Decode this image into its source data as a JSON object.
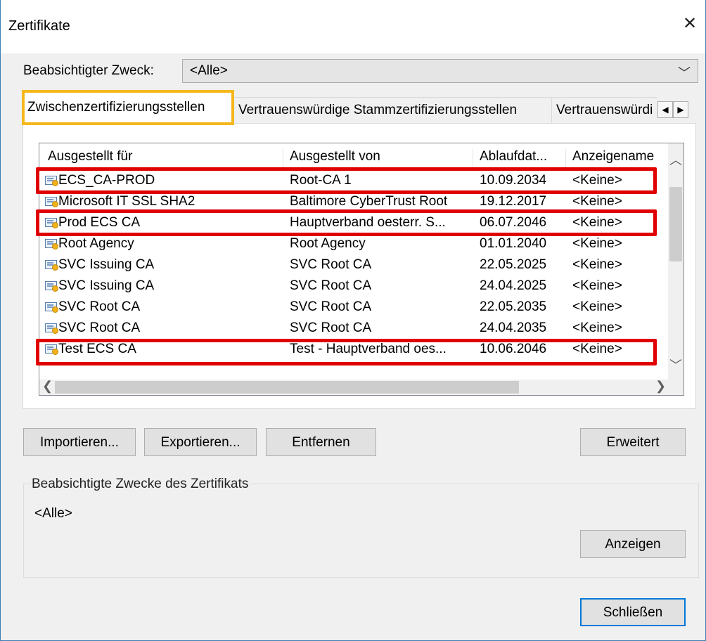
{
  "window": {
    "title": "Zertifikate",
    "close_symbol": "✕"
  },
  "purpose": {
    "label": "Beabsichtigter Zweck:",
    "value": "<Alle>",
    "chevron": "﹀"
  },
  "tabs": [
    {
      "label": "Zwischenzertifizierungsstellen",
      "selected": true
    },
    {
      "label": "Vertrauenswürdige Stammzertifizierungsstellen"
    },
    {
      "label": "Vertrauenswürdi"
    }
  ],
  "tab_scroll": {
    "left": "◀",
    "right": "▶"
  },
  "table": {
    "columns": [
      "Ausgestellt für",
      "Ausgestellt von",
      "Ablaufdat...",
      "Anzeigename"
    ],
    "rows": [
      {
        "issued_to": "ECS_CA-PROD",
        "issued_by": "Root-CA 1",
        "expires": "10.09.2034",
        "friendly_name": "<Keine>",
        "highlighted": true
      },
      {
        "issued_to": "Microsoft IT SSL SHA2",
        "issued_by": "Baltimore CyberTrust Root",
        "expires": "19.12.2017",
        "friendly_name": "<Keine>"
      },
      {
        "issued_to": "Prod ECS CA",
        "issued_by": "Hauptverband oesterr. S...",
        "expires": "06.07.2046",
        "friendly_name": "<Keine>",
        "highlighted": true
      },
      {
        "issued_to": "Root Agency",
        "issued_by": "Root Agency",
        "expires": "01.01.2040",
        "friendly_name": "<Keine>"
      },
      {
        "issued_to": "SVC Issuing CA",
        "issued_by": "SVC Root CA",
        "expires": "22.05.2025",
        "friendly_name": "<Keine>"
      },
      {
        "issued_to": "SVC Issuing CA",
        "issued_by": "SVC Root CA",
        "expires": "24.04.2025",
        "friendly_name": "<Keine>"
      },
      {
        "issued_to": "SVC Root CA",
        "issued_by": "SVC Root CA",
        "expires": "22.05.2035",
        "friendly_name": "<Keine>"
      },
      {
        "issued_to": "SVC Root CA",
        "issued_by": "SVC Root CA",
        "expires": "24.04.2035",
        "friendly_name": "<Keine>"
      },
      {
        "issued_to": "Test ECS CA",
        "issued_by": "Test - Hauptverband oes...",
        "expires": "10.06.2046",
        "friendly_name": "<Keine>",
        "highlighted": true
      }
    ],
    "scroll": {
      "up": "︿",
      "down": "﹀",
      "left": "❮",
      "right": "❯"
    }
  },
  "buttons": {
    "import": "Importieren...",
    "export": "Exportieren...",
    "remove": "Entfernen",
    "advanced": "Erweitert",
    "view": "Anzeigen",
    "close": "Schließen"
  },
  "purposes_group": {
    "legend": "Beabsichtigte Zwecke des Zertifikats",
    "value": "<Alle>"
  },
  "colors": {
    "tab_highlight": "#f5b81c",
    "row_highlight": "#e00000",
    "default_button_border": "#0078d7"
  }
}
